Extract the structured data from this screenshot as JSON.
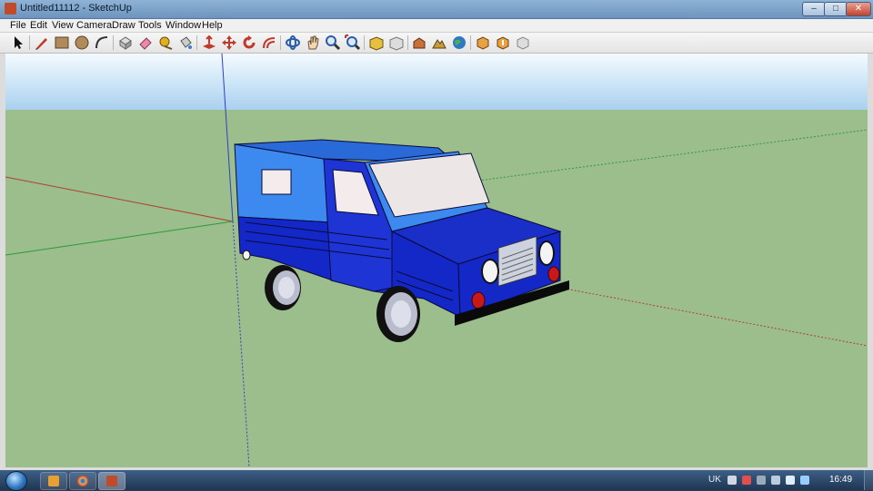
{
  "window": {
    "title": "Untitled11112 - SketchUp",
    "controls": {
      "minimize": "–",
      "maximize": "□",
      "close": "✕"
    }
  },
  "menu": [
    "File",
    "Edit",
    "View",
    "Camera",
    "Draw",
    "Tools",
    "Window",
    "Help"
  ],
  "toolbar": {
    "tools": [
      {
        "name": "select-icon"
      },
      {
        "name": "pencil-line-icon"
      },
      {
        "name": "rectangle-icon"
      },
      {
        "name": "circle-icon"
      },
      {
        "name": "arc-icon"
      },
      {
        "name": "make-component-icon"
      },
      {
        "name": "eraser-icon"
      },
      {
        "name": "tape-measure-icon"
      },
      {
        "name": "paint-bucket-icon"
      },
      {
        "name": "push-pull-icon"
      },
      {
        "name": "move-icon"
      },
      {
        "name": "rotate-icon"
      },
      {
        "name": "offset-icon"
      },
      {
        "name": "orbit-icon"
      },
      {
        "name": "pan-icon"
      },
      {
        "name": "zoom-icon"
      },
      {
        "name": "zoom-extents-icon"
      },
      {
        "name": "get-models-icon"
      },
      {
        "name": "share-model-icon"
      },
      {
        "name": "add-location-icon"
      },
      {
        "name": "toggle-terrain-icon"
      },
      {
        "name": "google-earth-icon"
      },
      {
        "name": "get-component-icon"
      },
      {
        "name": "share-component-icon"
      },
      {
        "name": "extension-warehouse-icon"
      }
    ]
  },
  "scene": {
    "sky_color": "#bcdcf4",
    "ground_color": "#9cbd8c",
    "vehicle_body_color": "#1428c8",
    "vehicle_cab_color": "#3c8af0"
  },
  "taskbar": {
    "language": "UK",
    "time": "16:49",
    "apps": [
      {
        "name": "media-player-icon"
      },
      {
        "name": "chrome-icon"
      },
      {
        "name": "sketchup-icon"
      }
    ]
  }
}
